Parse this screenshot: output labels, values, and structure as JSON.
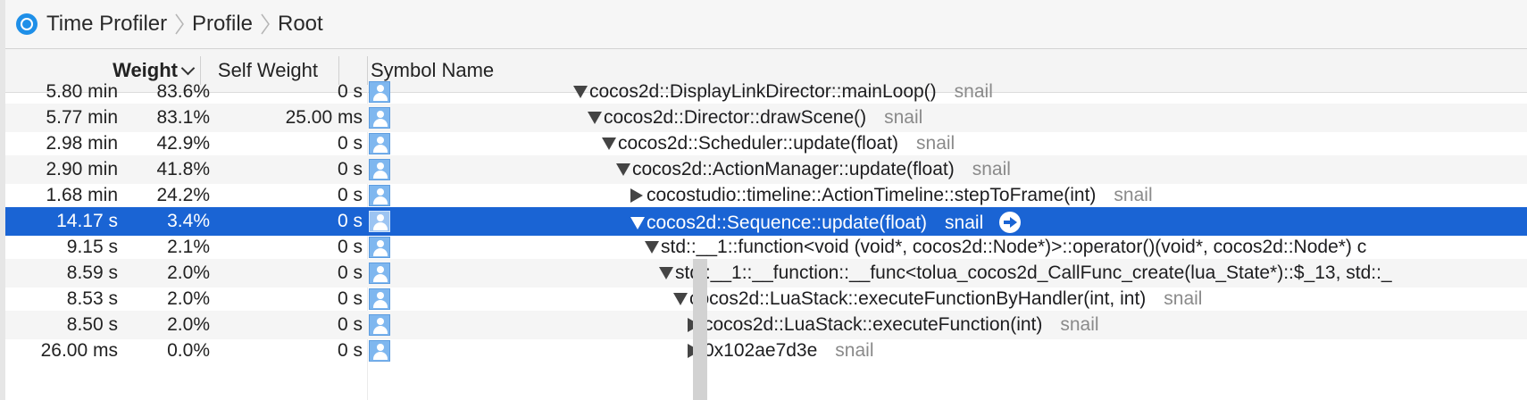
{
  "breadcrumb": {
    "app": "Time Profiler",
    "items": [
      "Profile",
      "Root"
    ]
  },
  "columns": {
    "weight": "Weight",
    "self_weight": "Self Weight",
    "symbol_name": "Symbol Name"
  },
  "rows": [
    {
      "time": "5.80 min",
      "pct": "83.6%",
      "self": "0 s",
      "symbol": "cocos2d::DisplayLinkDirector::mainLoop()",
      "lib": "snail",
      "depth": 0,
      "disclosure": "open"
    },
    {
      "time": "5.77 min",
      "pct": "83.1%",
      "self": "25.00 ms",
      "symbol": "cocos2d::Director::drawScene()",
      "lib": "snail",
      "depth": 1,
      "disclosure": "open"
    },
    {
      "time": "2.98 min",
      "pct": "42.9%",
      "self": "0 s",
      "symbol": "cocos2d::Scheduler::update(float)",
      "lib": "snail",
      "depth": 2,
      "disclosure": "open"
    },
    {
      "time": "2.90 min",
      "pct": "41.8%",
      "self": "0 s",
      "symbol": "cocos2d::ActionManager::update(float)",
      "lib": "snail",
      "depth": 3,
      "disclosure": "open"
    },
    {
      "time": "1.68 min",
      "pct": "24.2%",
      "self": "0 s",
      "symbol": "cocostudio::timeline::ActionTimeline::stepToFrame(int)",
      "lib": "snail",
      "depth": 4,
      "disclosure": "closed"
    },
    {
      "time": "14.17 s",
      "pct": "3.4%",
      "self": "0 s",
      "symbol": "cocos2d::Sequence::update(float)",
      "lib": "snail",
      "depth": 4,
      "disclosure": "open",
      "selected": true
    },
    {
      "time": "9.15 s",
      "pct": "2.1%",
      "self": "0 s",
      "symbol": "std::__1::function<void (void*, cocos2d::Node*)>::operator()(void*, cocos2d::Node*) c",
      "lib": "",
      "depth": 5,
      "disclosure": "open"
    },
    {
      "time": "8.59 s",
      "pct": "2.0%",
      "self": "0 s",
      "symbol": "std::__1::__function::__func<tolua_cocos2d_CallFunc_create(lua_State*)::$_13, std::_",
      "lib": "",
      "depth": 6,
      "disclosure": "open"
    },
    {
      "time": "8.53 s",
      "pct": "2.0%",
      "self": "0 s",
      "symbol": "cocos2d::LuaStack::executeFunctionByHandler(int, int)",
      "lib": "snail",
      "depth": 7,
      "disclosure": "open"
    },
    {
      "time": "8.50 s",
      "pct": "2.0%",
      "self": "0 s",
      "symbol": "cocos2d::LuaStack::executeFunction(int)",
      "lib": "snail",
      "depth": 8,
      "disclosure": "closed"
    },
    {
      "time": "26.00 ms",
      "pct": "0.0%",
      "self": "0 s",
      "symbol": "0x102ae7d3e",
      "lib": "snail",
      "depth": 8,
      "disclosure": "closed"
    }
  ]
}
